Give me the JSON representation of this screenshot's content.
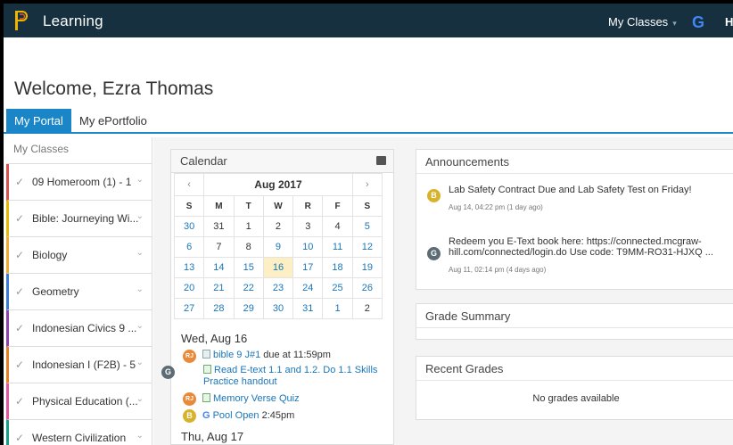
{
  "app": {
    "title": "Learning",
    "my_classes": "My Classes",
    "google_letter": "G",
    "truncated_letter": "H"
  },
  "welcome": "Welcome, Ezra Thomas",
  "tabs": [
    {
      "label": "My Portal",
      "active": true
    },
    {
      "label": "My ePortfolio",
      "active": false
    }
  ],
  "sidebar": {
    "header": "My Classes",
    "classes": [
      {
        "label": "09 Homeroom (1) - 1",
        "color": "#d9534f"
      },
      {
        "label": "Bible: Journeying Wi...",
        "color": "#e6b800"
      },
      {
        "label": "Biology",
        "color": "#f0a830"
      },
      {
        "label": "Geometry",
        "color": "#3a7bd5"
      },
      {
        "label": "Indonesian Civics 9 ...",
        "color": "#8e44ad"
      },
      {
        "label": "Indonesian I (F2B) - 5",
        "color": "#e67e22"
      },
      {
        "label": "Physical Education (...",
        "color": "#e056a0"
      },
      {
        "label": "Western Civilization",
        "color": "#16a085"
      }
    ]
  },
  "calendar": {
    "header": "Calendar",
    "prev": "‹",
    "next": "›",
    "month": "Aug 2017",
    "dow": [
      "S",
      "M",
      "T",
      "W",
      "R",
      "F",
      "S"
    ],
    "weeks": [
      [
        "30",
        "31",
        "1",
        "2",
        "3",
        "4",
        "5"
      ],
      [
        "6",
        "7",
        "8",
        "9",
        "10",
        "11",
        "12"
      ],
      [
        "13",
        "14",
        "15",
        "16",
        "17",
        "18",
        "19"
      ],
      [
        "20",
        "21",
        "22",
        "23",
        "24",
        "25",
        "26"
      ],
      [
        "27",
        "28",
        "29",
        "30",
        "31",
        "1",
        "2"
      ]
    ],
    "today": "16",
    "agenda": {
      "day1": "Wed, Aug 16",
      "day2": "Thu, Aug 17",
      "events": [
        {
          "badge": "RJ",
          "title": "bible 9 J#1",
          "suffix": " due at 11:59pm"
        },
        {
          "badge": "G",
          "title": "Read E-text 1.1 and 1.2. Do 1.1 Skills Practice handout",
          "suffix": ""
        },
        {
          "badge": "RJ",
          "title": "Memory Verse Quiz",
          "suffix": ""
        },
        {
          "badge": "B",
          "title": "Pool Open",
          "suffix": " 2:45pm"
        }
      ]
    }
  },
  "announcements": {
    "header": "Announcements",
    "items": [
      {
        "badge": "B",
        "text": "Lab Safety Contract Due and Lab Safety Test on Friday!",
        "date": "Aug 14, 04:22 pm (1 day ago)"
      },
      {
        "badge": "G",
        "text_line1": "Redeem you E-Text book here: https://connected.mcgraw-",
        "text_line2": "hill.com/connected/login.do Use code: T9MM-RO31-HJXQ ...",
        "date": "Aug 11, 02:14 pm (4 days ago)"
      }
    ]
  },
  "grade_summary": {
    "header": "Grade Summary"
  },
  "recent_grades": {
    "header": "Recent Grades",
    "empty": "No grades available"
  },
  "icons": {
    "logo": "p-logo",
    "check": "check-icon",
    "chevron": "chevron-down-icon",
    "print": "print-icon"
  }
}
